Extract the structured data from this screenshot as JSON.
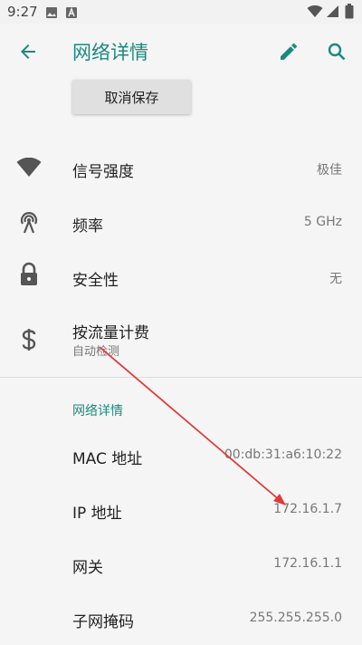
{
  "status_bar": {
    "time": "9:27",
    "left_icons": [
      "image-icon",
      "a-box-icon"
    ],
    "right_icons": [
      "wifi-icon",
      "signal-icon",
      "battery-icon"
    ]
  },
  "toolbar": {
    "title": "网络详情",
    "back_icon": "arrow-left-icon",
    "edit_icon": "pencil-icon",
    "search_icon": "search-icon"
  },
  "cancel_save": "取消保存",
  "rows": [
    {
      "label": "信号强度",
      "value": "极佳",
      "icon": "wifi-signal-icon"
    },
    {
      "label": "频率",
      "value": "5 GHz",
      "icon": "broadcast-icon"
    },
    {
      "label": "安全性",
      "value": "无",
      "icon": "lock-icon"
    },
    {
      "label": "按流量计费",
      "sub": "自动检测",
      "icon": "dollar-icon"
    }
  ],
  "section_title": "网络详情",
  "details": [
    {
      "label": "MAC 地址",
      "value": "00:db:31:a6:10:22"
    },
    {
      "label": "IP 地址",
      "value": "172.16.1.7"
    },
    {
      "label": "网关",
      "value": "172.16.1.1"
    },
    {
      "label": "子网掩码",
      "value": "255.255.255.0"
    }
  ],
  "colors": {
    "accent": "#1b8a7e",
    "annotation_arrow": "#e23a3a",
    "background": "#f5f5f5"
  }
}
